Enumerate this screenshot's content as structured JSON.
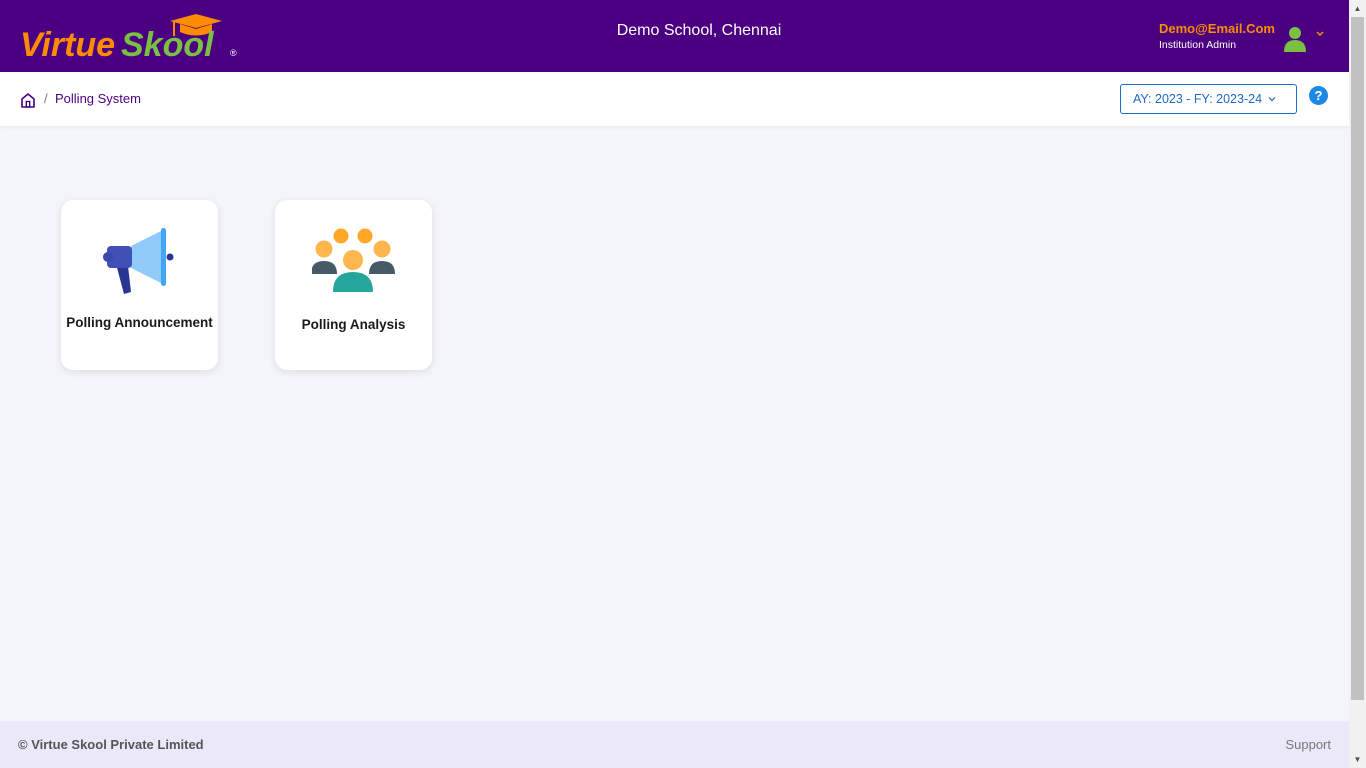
{
  "header": {
    "logo_text_virtue": "Virtue",
    "logo_text_skool": "Skool",
    "logo_mark": "®",
    "school_name": "Demo School, Chennai",
    "user_email": "Demo@Email.Com",
    "user_role": "Institution Admin"
  },
  "breadcrumb": {
    "separator": "/",
    "current": "Polling System"
  },
  "year_selector": {
    "value": "AY: 2023 - FY: 2023-24"
  },
  "help": {
    "label": "?"
  },
  "cards": [
    {
      "label": "Polling Announcement",
      "icon": "megaphone-icon"
    },
    {
      "label": "Polling Analysis",
      "icon": "people-group-icon"
    }
  ],
  "footer": {
    "copyright": "© Virtue Skool Private Limited",
    "support": "Support"
  },
  "colors": {
    "header_bg": "#4b0082",
    "accent_orange": "#ff8c00",
    "logo_green": "#7ac143",
    "link_blue": "#1f69c7",
    "footer_bg": "#ebe8fa"
  }
}
